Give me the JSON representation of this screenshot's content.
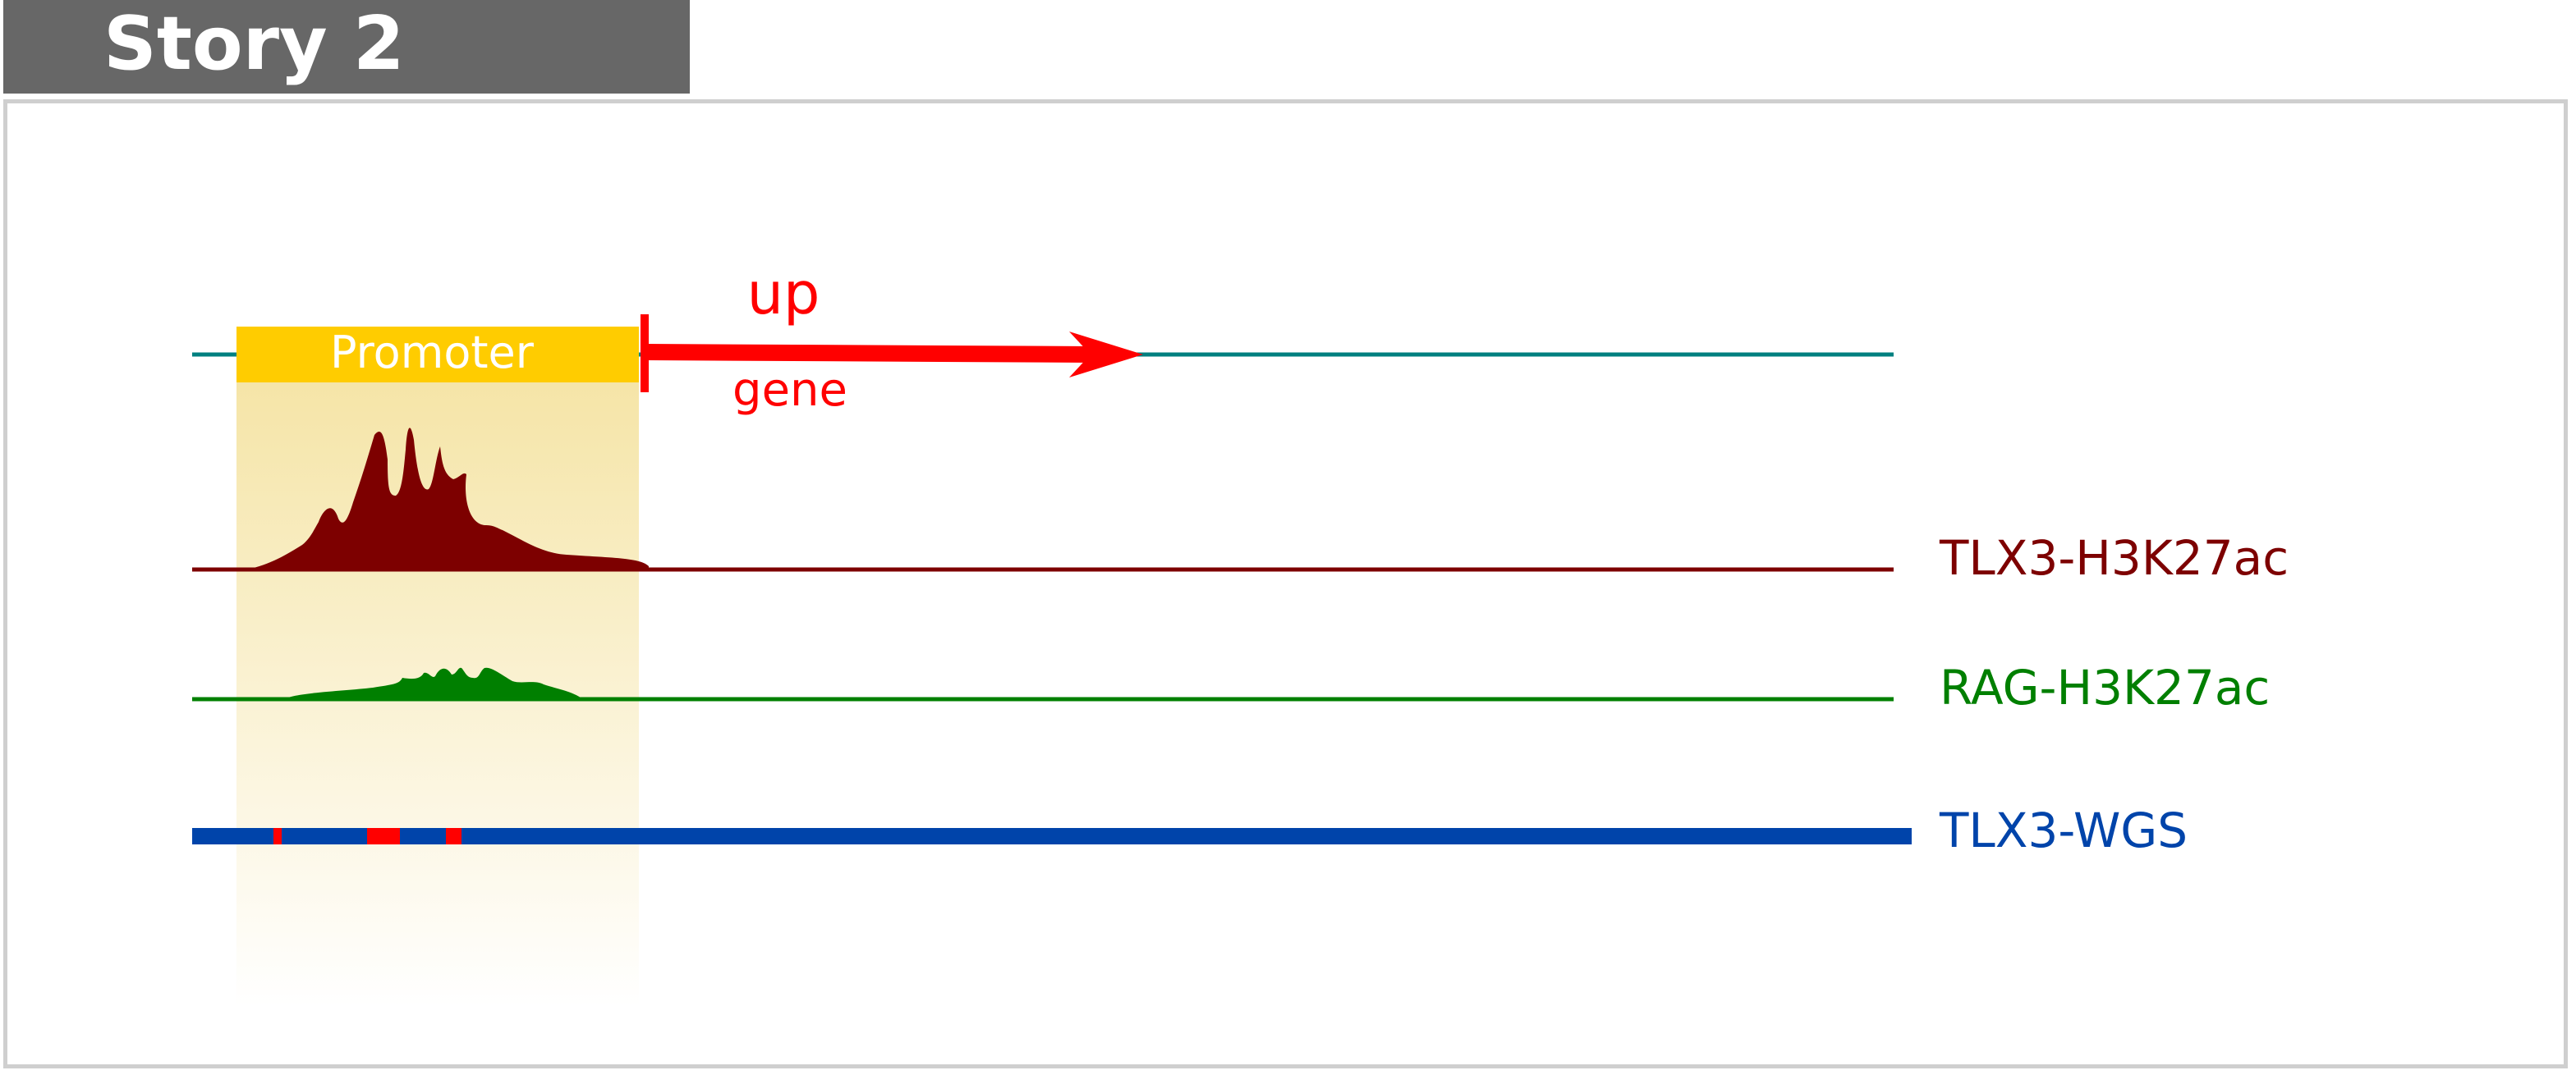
{
  "header": {
    "title": "Story 2"
  },
  "diagram": {
    "promoter_label": "Promoter",
    "gene_direction_label": "up",
    "gene_label": "gene",
    "tracks": [
      {
        "label": "TLX3-H3K27ac",
        "color": "#7d0000"
      },
      {
        "label": "RAG-H3K27ac",
        "color": "#007f00"
      },
      {
        "label": "TLX3-WGS",
        "color": "#0044aa"
      }
    ],
    "colors": {
      "gene_axis": "#008080",
      "arrow": "#ff0000",
      "promoter_box": "#ffcc00",
      "promoter_shade": "#f2dc8a",
      "variant_marks": "#ff0000",
      "title_bar": "#676767",
      "panel_border": "#cfcfcf"
    }
  }
}
